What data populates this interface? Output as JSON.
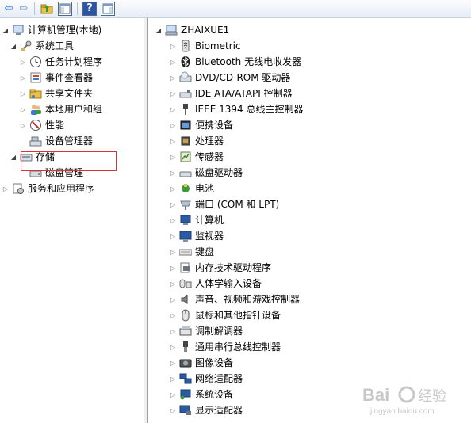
{
  "left_tree": [
    {
      "id": "root",
      "label": "计算机管理(本地)",
      "icon": "computer-management-icon",
      "expander": "open"
    },
    {
      "id": "system-tools",
      "label": "系统工具",
      "icon": "system-tools-icon",
      "expander": "open"
    },
    {
      "id": "task-scheduler",
      "label": "任务计划程序",
      "icon": "task-scheduler-icon",
      "expander": "closed"
    },
    {
      "id": "event-viewer",
      "label": "事件查看器",
      "icon": "event-viewer-icon",
      "expander": "closed"
    },
    {
      "id": "shared-folders",
      "label": "共享文件夹",
      "icon": "shared-folder-icon",
      "expander": "closed"
    },
    {
      "id": "local-users",
      "label": "本地用户和组",
      "icon": "users-icon",
      "expander": "closed"
    },
    {
      "id": "performance",
      "label": "性能",
      "icon": "performance-icon",
      "expander": "closed"
    },
    {
      "id": "device-manager",
      "label": "设备管理器",
      "icon": "device-manager-icon",
      "expander": "none"
    },
    {
      "id": "storage",
      "label": "存储",
      "icon": "storage-icon",
      "expander": "open"
    },
    {
      "id": "disk-management",
      "label": "磁盘管理",
      "icon": "disk-management-icon",
      "expander": "none"
    },
    {
      "id": "services-apps",
      "label": "服务和应用程序",
      "icon": "services-icon",
      "expander": "closed"
    }
  ],
  "right_tree": {
    "root_label": "ZHAIXUE1",
    "items": [
      {
        "label": "Biometric",
        "icon": "biometric-icon"
      },
      {
        "label": "Bluetooth 无线电收发器",
        "icon": "bluetooth-icon"
      },
      {
        "label": "DVD/CD-ROM 驱动器",
        "icon": "dvd-drive-icon"
      },
      {
        "label": "IDE ATA/ATAPI 控制器",
        "icon": "ide-controller-icon"
      },
      {
        "label": "IEEE 1394 总线主控制器",
        "icon": "ieee1394-icon"
      },
      {
        "label": "便携设备",
        "icon": "portable-device-icon"
      },
      {
        "label": "处理器",
        "icon": "processor-icon"
      },
      {
        "label": "传感器",
        "icon": "sensor-icon"
      },
      {
        "label": "磁盘驱动器",
        "icon": "disk-drive-icon"
      },
      {
        "label": "电池",
        "icon": "battery-icon"
      },
      {
        "label": "端口 (COM 和 LPT)",
        "icon": "port-icon"
      },
      {
        "label": "计算机",
        "icon": "computer-icon"
      },
      {
        "label": "监视器",
        "icon": "monitor-icon"
      },
      {
        "label": "键盘",
        "icon": "keyboard-icon"
      },
      {
        "label": "内存技术驱动程序",
        "icon": "memory-tech-icon"
      },
      {
        "label": "人体学输入设备",
        "icon": "hid-icon"
      },
      {
        "label": "声音、视频和游戏控制器",
        "icon": "sound-icon"
      },
      {
        "label": "鼠标和其他指针设备",
        "icon": "mouse-icon"
      },
      {
        "label": "调制解调器",
        "icon": "modem-icon"
      },
      {
        "label": "通用串行总线控制器",
        "icon": "usb-icon"
      },
      {
        "label": "图像设备",
        "icon": "imaging-device-icon"
      },
      {
        "label": "网络适配器",
        "icon": "network-adapter-icon"
      },
      {
        "label": "系统设备",
        "icon": "system-device-icon"
      },
      {
        "label": "显示适配器",
        "icon": "display-adapter-icon"
      }
    ]
  },
  "watermark": {
    "brand": "Bai",
    "brand2": "经验",
    "sub": "jingyan.baidu.com"
  },
  "colors": {
    "highlight_border": "#e03030",
    "splitter": "#a0a0a0"
  }
}
